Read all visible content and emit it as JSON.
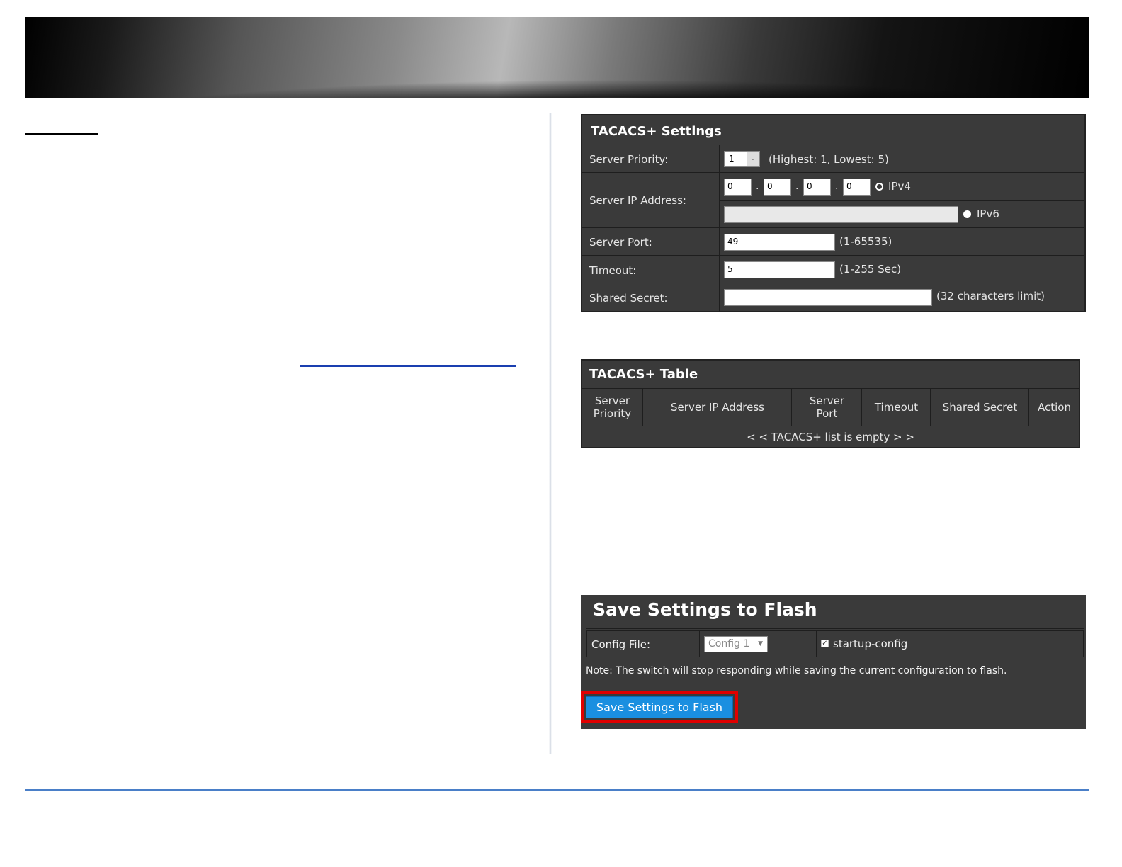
{
  "settings": {
    "title": "TACACS+ Settings",
    "priority_label": "Server Priority:",
    "priority_value": "1",
    "priority_hint": "(Highest: 1, Lowest: 5)",
    "ip_label": "Server IP Address:",
    "ip_octets": [
      "0",
      "0",
      "0",
      "0"
    ],
    "ip_dot": ".",
    "ipv4_label": "IPv4",
    "ipv6_value": "",
    "ipv6_label": "IPv6",
    "ip_mode_selected": "IPv6",
    "port_label": "Server Port:",
    "port_value": "49",
    "port_hint": "(1-65535)",
    "timeout_label": "Timeout:",
    "timeout_value": "5",
    "timeout_hint": "(1-255 Sec)",
    "secret_label": "Shared Secret:",
    "secret_value": "",
    "secret_hint": "(32 characters limit)"
  },
  "table": {
    "title": "TACACS+ Table",
    "headers": [
      "Server\nPriority",
      "Server IP Address",
      "Server\nPort",
      "Timeout",
      "Shared Secret",
      "Action"
    ],
    "empty_message": "< < TACACS+ list is empty > >"
  },
  "save": {
    "title": "Save Settings to Flash",
    "config_label": "Config File:",
    "config_value": "Config 1",
    "startup_label": "startup-config",
    "startup_checked": true,
    "note": "Note: The switch will stop responding while saving the current configuration to flash.",
    "button_label": "Save Settings to Flash"
  },
  "colors": {
    "panel_bg": "#3a3a3a",
    "button_bg": "#1a8fe0",
    "highlight_border": "#e00000",
    "footer_line": "#4a7fc8"
  }
}
